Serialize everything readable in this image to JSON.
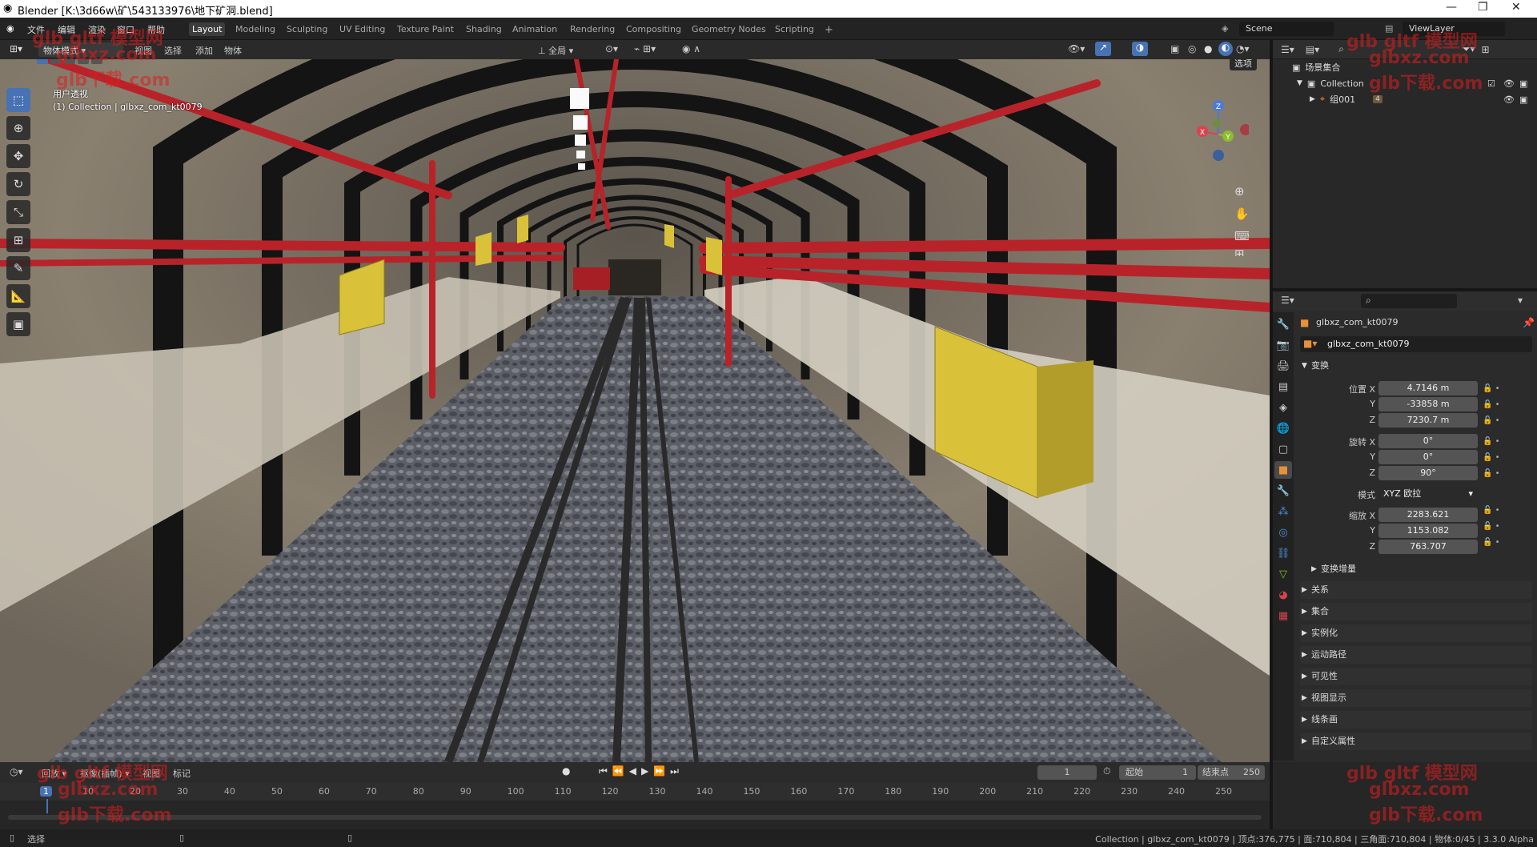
{
  "window": {
    "title": "Blender [K:\\3d66w\\矿\\543133976\\地下矿洞.blend]"
  },
  "menus": [
    "文件",
    "编辑",
    "渲染",
    "窗口",
    "帮助"
  ],
  "workspaces": [
    "Layout",
    "Modeling",
    "Sculpting",
    "UV Editing",
    "Texture Paint",
    "Shading",
    "Animation",
    "Rendering",
    "Compositing",
    "Geometry Nodes",
    "Scripting"
  ],
  "active_workspace": "Layout",
  "scene": {
    "name": "Scene",
    "view_layer": "ViewLayer"
  },
  "viewport_header": {
    "mode": "物体模式",
    "menus": [
      "视图",
      "选择",
      "添加",
      "物体"
    ],
    "orientation": "全局",
    "options": "选项"
  },
  "viewport": {
    "view_name": "用户透视",
    "collection_info": "(1) Collection | glbxz_com_kt0079"
  },
  "gizmo": {
    "x": "X",
    "y": "Y",
    "z": "Z"
  },
  "outliner": {
    "root": "场景集合",
    "collection": "Collection",
    "child": "组001",
    "child_count": "4"
  },
  "properties": {
    "object_name": "glbxz_com_kt0079",
    "data_name": "glbxz_com_kt0079",
    "transform_label": "变换",
    "location_label": "位置 X",
    "location": {
      "x": "4.7146 m",
      "y": "-33858 m",
      "z": "7230.7 m"
    },
    "rotation_label": "旋转 X",
    "rotation": {
      "x": "0°",
      "y": "0°",
      "z": "90°"
    },
    "mode_label": "模式",
    "rotation_mode": "XYZ 欧拉",
    "scale_label": "缩放 X",
    "scale": {
      "x": "2283.621",
      "y": "1153.082",
      "z": "763.707"
    },
    "y_label": "Y",
    "z_label": "Z",
    "delta_label": "变换增量",
    "sections": [
      "关系",
      "集合",
      "实例化",
      "运动路径",
      "可见性",
      "视图显示",
      "线条画",
      "自定义属性"
    ]
  },
  "timeline": {
    "menus": [
      "回放",
      "抠像(插帧)",
      "视图",
      "标记"
    ],
    "current_frame": "1",
    "start_label": "起始",
    "start": "1",
    "end_label": "结束点",
    "end": "250",
    "ticks": [
      "1",
      "10",
      "20",
      "30",
      "40",
      "50",
      "60",
      "70",
      "80",
      "90",
      "100",
      "110",
      "120",
      "130",
      "140",
      "150",
      "160",
      "170",
      "180",
      "190",
      "200",
      "210",
      "220",
      "230",
      "240",
      "250"
    ]
  },
  "statusbar": {
    "left": "选择",
    "right": "Collection | glbxz_com_kt0079 | 顶点:376,775 | 面:710,804 | 三角面:710,804 | 物体:0/45 | 3.3.0 Alpha"
  },
  "watermarks": [
    "glb gltf 模型网",
    "glbxz.com",
    "glb下载.com"
  ],
  "colors": {
    "accent": "#4772b3",
    "pipe": "#b8232a",
    "box": "#d9c23a",
    "header": "#232323"
  }
}
